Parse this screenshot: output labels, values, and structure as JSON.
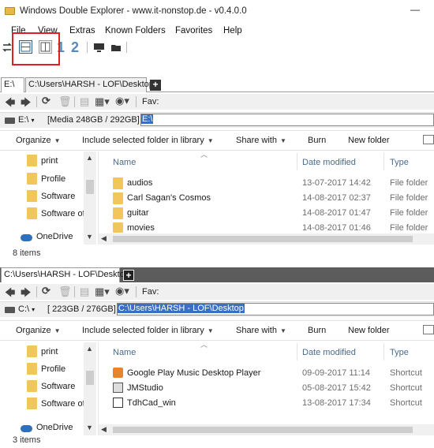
{
  "window": {
    "title": "Windows Double Explorer - www.it-nonstop.de - v0.4.0.0",
    "minimize_glyph": "—"
  },
  "menu": [
    "File",
    "View",
    "Extras",
    "Known Folders",
    "Favorites",
    "Help"
  ],
  "toolbar": {
    "layout_1": "1",
    "layout_2": "2"
  },
  "pane1": {
    "tabs": [
      "E:\\",
      "C:\\Users\\HARSH - LOF\\Desktop"
    ],
    "add_tab": "+",
    "fav_label": "Fav:",
    "drive_label": "E:\\",
    "drive_info": "[Media 248GB / 292GB]",
    "path_value": "E:\\",
    "commands": {
      "organize": "Organize",
      "include": "Include selected folder in library",
      "share": "Share with",
      "burn": "Burn",
      "new_folder": "New folder"
    },
    "nav_items": [
      "print",
      "Profile",
      "Software",
      "Software of"
    ],
    "onedrive": "OneDrive",
    "columns": {
      "name": "Name",
      "date": "Date modified",
      "type": "Type"
    },
    "rows": [
      {
        "name": "audios",
        "date": "13-07-2017 14:42",
        "type": "File folder"
      },
      {
        "name": "Carl Sagan's Cosmos",
        "date": "14-08-2017 02:37",
        "type": "File folder"
      },
      {
        "name": "guitar",
        "date": "14-08-2017 01:47",
        "type": "File folder"
      },
      {
        "name": "movies",
        "date": "14-08-2017 01:46",
        "type": "File folder"
      }
    ],
    "status": "8 items"
  },
  "pane2": {
    "tabs": [
      "C:\\Users\\HARSH - LOF\\Desktop"
    ],
    "add_tab": "+",
    "fav_label": "Fav:",
    "drive_label": "C:\\",
    "drive_info": "[ 223GB / 276GB]",
    "path_value": "C:\\Users\\HARSH - LOF\\Desktop",
    "commands": {
      "organize": "Organize",
      "include": "Include selected folder in library",
      "share": "Share with",
      "burn": "Burn",
      "new_folder": "New folder"
    },
    "nav_items": [
      "print",
      "Profile",
      "Software",
      "Software of"
    ],
    "onedrive": "OneDrive",
    "columns": {
      "name": "Name",
      "date": "Date modified",
      "type": "Type"
    },
    "rows": [
      {
        "name": "Google Play Music Desktop Player",
        "date": "09-09-2017 11:14",
        "type": "Shortcut"
      },
      {
        "name": "JMStudio",
        "date": "05-08-2017 15:42",
        "type": "Shortcut"
      },
      {
        "name": "TdhCad_win",
        "date": "13-08-2017 17:34",
        "type": "Shortcut"
      }
    ],
    "status": "3 items"
  }
}
